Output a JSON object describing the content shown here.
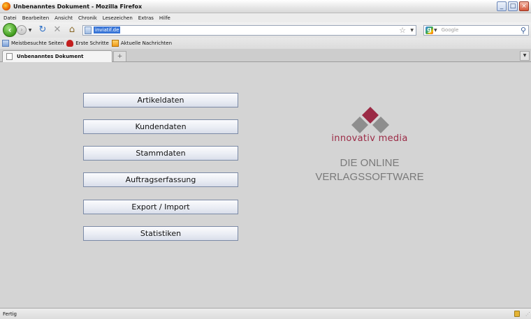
{
  "window": {
    "title": "Unbenanntes Dokument - Mozilla Firefox",
    "minimize_glyph": "_",
    "maximize_glyph": "□",
    "close_glyph": "×"
  },
  "menubar": {
    "items": [
      "Datei",
      "Bearbeiten",
      "Ansicht",
      "Chronik",
      "Lesezeichen",
      "Extras",
      "Hilfe"
    ]
  },
  "navbar": {
    "url": "inviatif.de",
    "search_placeholder": "Google",
    "icons": [
      "back-arrow-icon",
      "forward-arrow-icon",
      "reload-icon",
      "stop-icon",
      "home-icon",
      "star-icon",
      "magnifier-icon"
    ]
  },
  "bookmarks": {
    "items": [
      "Meistbesuchte Seiten",
      "Erste Schritte",
      "Aktuelle Nachrichten"
    ]
  },
  "tabs": {
    "items": [
      {
        "label": "Unbenanntes Dokument"
      }
    ],
    "new_tab_glyph": "+"
  },
  "main": {
    "buttons": [
      "Artikeldaten",
      "Kundendaten",
      "Stammdaten",
      "Auftragserfassung",
      "Export / Import",
      "Statistiken"
    ],
    "brand": "innovativ media",
    "tagline_line1": "DIE ONLINE",
    "tagline_line2": "VERLAGSSOFTWARE",
    "colors": {
      "brand_red": "#9b2a45",
      "logo_gray": "#8e8e8e",
      "tagline_gray": "#7a7a7a"
    }
  },
  "status": {
    "text": "Fertig"
  }
}
